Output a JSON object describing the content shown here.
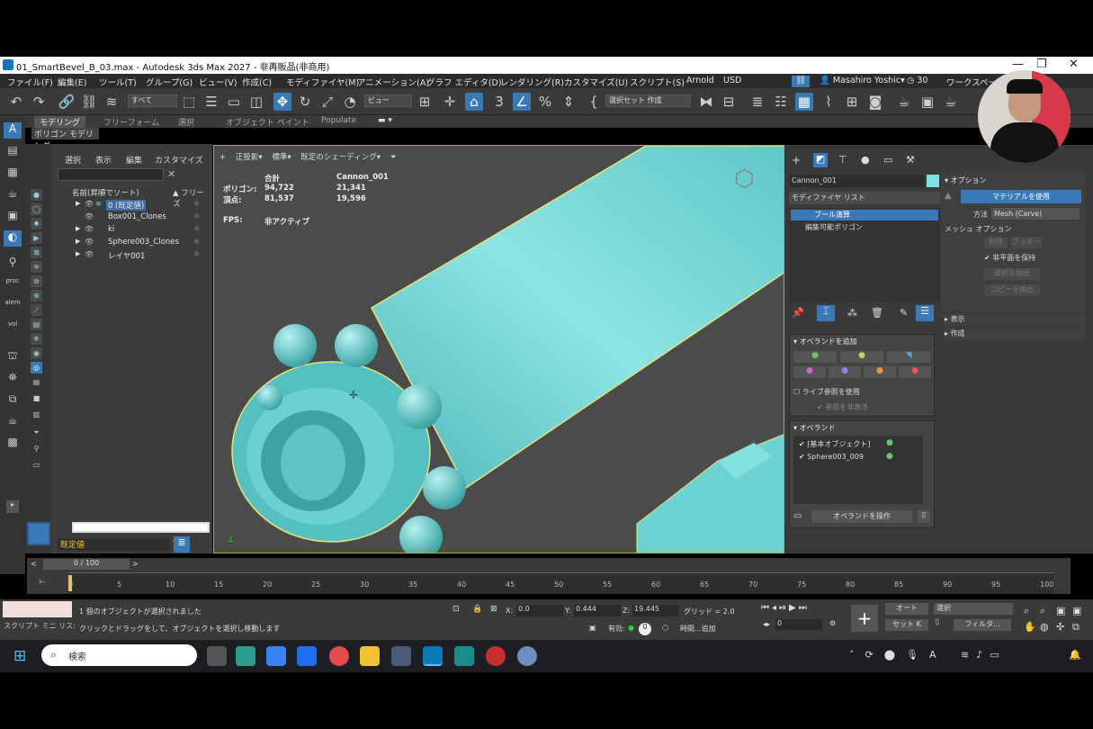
{
  "title": "01_SmartBevel_B_03.max - Autodesk 3ds Max 2027 - 非再販品(非商用)",
  "menu": [
    "ファイル(F)",
    "編集(E)",
    "ツール(T)",
    "グループ(G)",
    "ビュー(V)",
    "作成(C)",
    "モディファイヤ(M)",
    "アニメーション(A)",
    "グラフ エディタ(D)",
    "レンダリング(R)",
    "カスタマイズ(U)",
    "スクリプト(S)",
    "Arnold",
    "USD"
  ],
  "user": "Masahiro Yoshic▾",
  "clock_count": "30",
  "workspace_label": "ワークスペース:",
  "toolbar": {
    "filter": "すべて",
    "view": "ビュー",
    "selset": "選択セット 作成"
  },
  "ribbon_tabs": [
    "モデリング",
    "フリーフォーム",
    "選択",
    "オブジェクト ペイント",
    "Populate"
  ],
  "ribbon_sub": "ポリゴン モデリング",
  "left_labels": {
    "proc": "proc",
    "alem": "alem",
    "vol": "vol"
  },
  "explorer": {
    "tabs": [
      "選択",
      "表示",
      "編集",
      "カスタマイズ"
    ],
    "header_name": "名前(昇順でソート)",
    "header_freeze": "▲ フリーズ",
    "rows": [
      "0 (既定値)",
      "Box001_Clones",
      "ki",
      "Sphere003_Clones",
      "レイヤ001"
    ],
    "layer": "既定値"
  },
  "viewport": {
    "labels": [
      "+",
      "正投影▾",
      "標準▾",
      "既定のシェーディング▾"
    ],
    "stat_head_total": "合計",
    "stat_head_obj": "Cannon_001",
    "poly_label": "ポリゴン:",
    "poly_total": "94,722",
    "poly_obj": "21,341",
    "vert_label": "頂点:",
    "vert_total": "81,537",
    "vert_obj": "19,596",
    "fps_label": "FPS:",
    "fps_value": "非アクティブ"
  },
  "command": {
    "object_name": "Cannon_001",
    "object_color": "#7fe3e6",
    "modifier_list": "モディファイヤ リスト",
    "stack": [
      "ブール演算",
      "編集可能ポリゴン"
    ],
    "options_title": "オプション",
    "use_material": "マテリアルを使用",
    "method_label": "方法",
    "method_value": "Mesh (Carve)",
    "mesh_options": "メッシュ オプション",
    "delete_btn": "削除",
    "cookie_btn": "クッキー",
    "keep_nonplanar": "非平面を保持",
    "extract_sel": "選択を抽出",
    "extract_copy": "コピーを抽出",
    "display": "表示",
    "create": "作成",
    "add_operand": "オペランドを追加",
    "live_ref": "ライブ参照を使用",
    "hide_ref": "参照を非表示",
    "operands": "オペランド",
    "operand_items": [
      "[基本オブジェクト]",
      "Sphere003_009"
    ],
    "operate": "オペランドを操作"
  },
  "timeline": {
    "frame": "0 / 100",
    "ticks": [
      "0",
      "5",
      "10",
      "15",
      "20",
      "25",
      "30",
      "35",
      "40",
      "45",
      "50",
      "55",
      "60",
      "65",
      "70",
      "75",
      "80",
      "85",
      "90",
      "95",
      "100"
    ]
  },
  "status": {
    "script_tabs": "スクリプト ミニ リス:",
    "line1": "1 個のオブジェクトが選択されました",
    "line2": "クリックとドラッグをして、オブジェクトを選択し移動します",
    "x": "0.0",
    "y": "0.444",
    "z": "19.445",
    "grid": "グリッド = 2.0",
    "enabled": "有効:",
    "time_add": "時間...追加",
    "auto": "オート",
    "setkey": "セット K",
    "select": "選択",
    "filter": "フィルタ...",
    "frame_field": "0"
  },
  "taskbar": {
    "search": "検索"
  },
  "colors": {
    "cyan": "#6fd6d8",
    "selection": "#e9e37a",
    "accent": "#3a79b8"
  }
}
